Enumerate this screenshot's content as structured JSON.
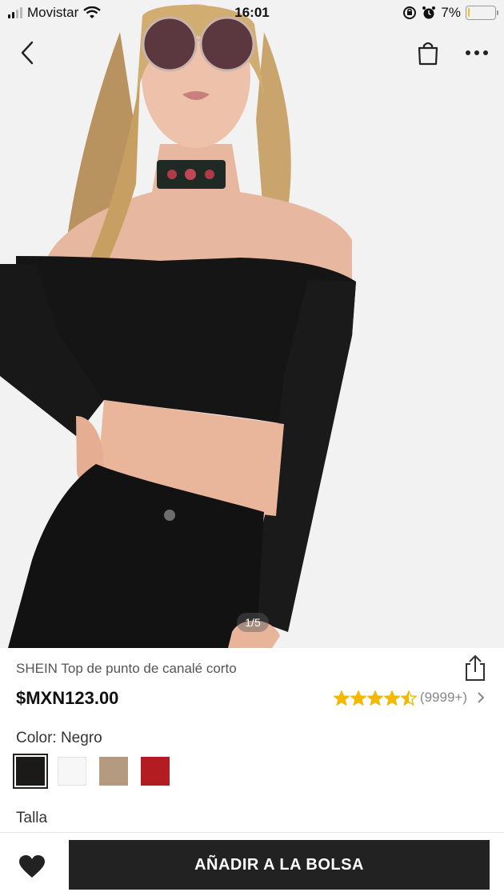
{
  "status_bar": {
    "carrier": "Movistar",
    "time": "16:01",
    "battery_percent": "7%",
    "battery_level": 0.07,
    "icons": [
      "signal-icon",
      "wifi-icon",
      "orientation-lock-icon",
      "alarm-icon",
      "battery-icon"
    ]
  },
  "nav": {
    "back_icon": "chevron-left-icon",
    "bag_icon": "shopping-bag-icon",
    "more_icon": "more-dots-icon"
  },
  "gallery": {
    "pager": "1/5"
  },
  "product": {
    "title": "SHEIN Top de punto de canalé corto",
    "price": "$MXN123.00",
    "rating_value": 4.5,
    "rating_count": "(9999+)",
    "share_icon": "share-icon"
  },
  "color": {
    "label": "Color: Negro",
    "swatches": [
      {
        "name": "Negro",
        "hex": "#1b1a19",
        "selected": true
      },
      {
        "name": "Blanco",
        "hex": "#f7f7f7",
        "selected": false
      },
      {
        "name": "Caqui",
        "hex": "#b49a7f",
        "selected": false
      },
      {
        "name": "Rojo",
        "hex": "#b31d22",
        "selected": false
      }
    ]
  },
  "size": {
    "label": "Talla"
  },
  "bottom_bar": {
    "wishlist_icon": "heart-icon",
    "add_to_bag": "AÑADIR A LA BOLSA"
  },
  "colors": {
    "star": "#f5b800",
    "button_bg": "#222222",
    "battery_low": "#f2c01e"
  }
}
